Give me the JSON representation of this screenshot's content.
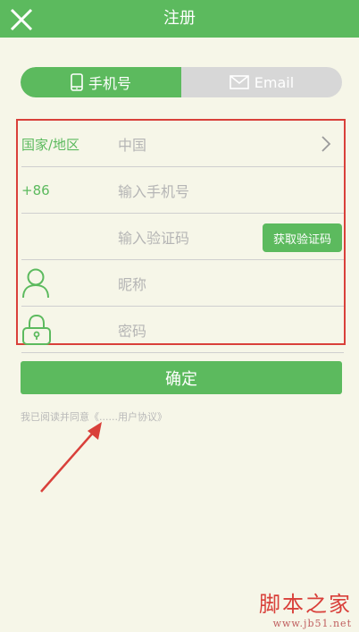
{
  "header": {
    "title": "注册"
  },
  "tabs": [
    {
      "label": "手机号",
      "icon": "phone-icon",
      "active": true
    },
    {
      "label": "Email",
      "icon": "mail-icon",
      "active": false
    }
  ],
  "form": {
    "region": {
      "label": "国家/地区",
      "value": "中国"
    },
    "phone": {
      "prefix": "+86",
      "placeholder": "输入手机号"
    },
    "code": {
      "placeholder": "输入验证码",
      "button": "获取验证码"
    },
    "nickname": {
      "placeholder": "昵称",
      "icon": "user-icon"
    },
    "password": {
      "placeholder": "密码",
      "icon": "lock-icon"
    }
  },
  "confirm_label": "确定",
  "agreement": "我已阅读并同意《......用户协议》",
  "watermark": {
    "main": "脚本之家",
    "sub": "www.jb51.net"
  },
  "colors": {
    "accent": "#5cba5e",
    "highlight": "#d9403a",
    "background": "#f6f6e8"
  }
}
